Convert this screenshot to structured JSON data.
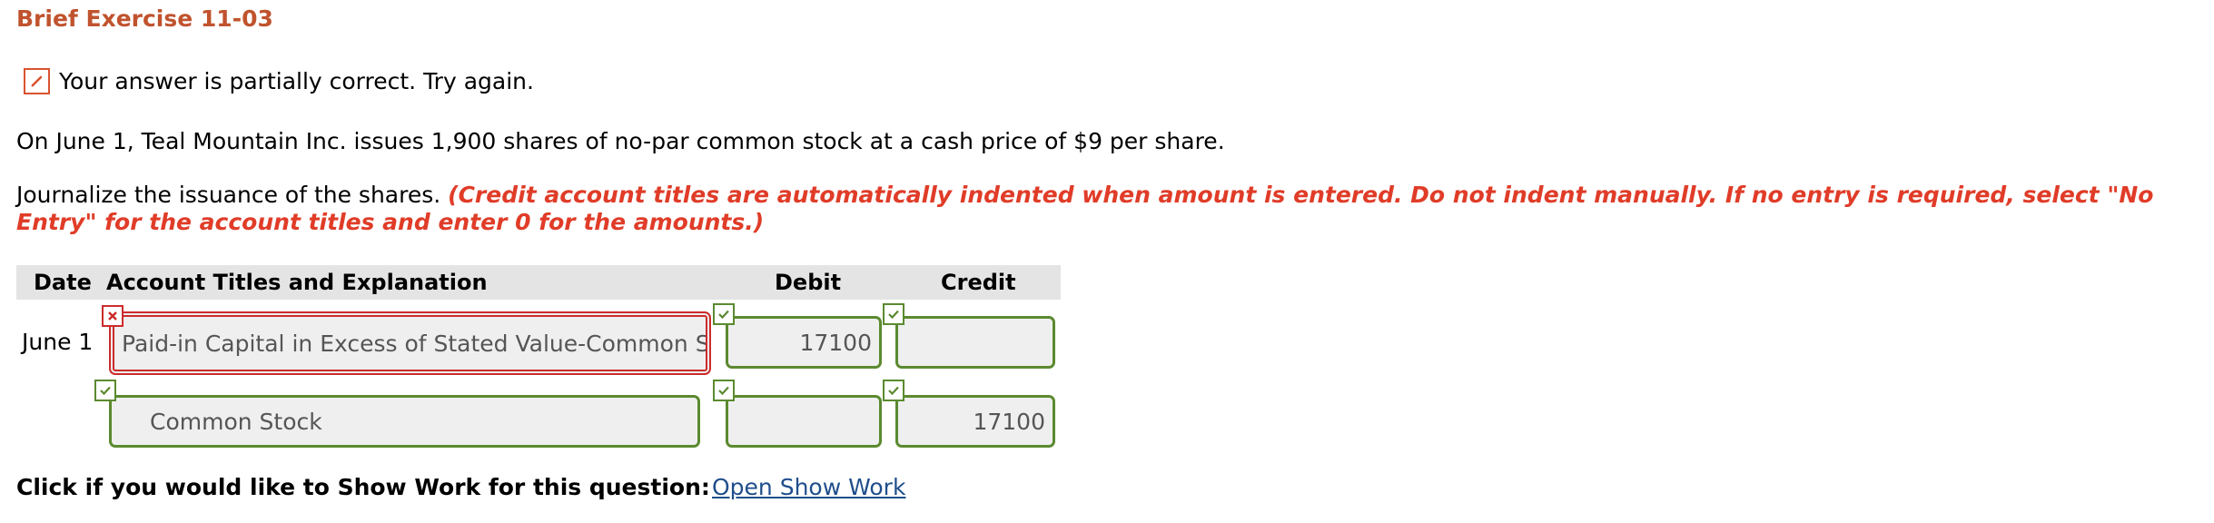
{
  "exercise_title": "Brief Exercise 11-03",
  "feedback": {
    "icon": "pencil-icon",
    "message": "Your answer is partially correct.  Try again."
  },
  "problem_text": "On June 1, Teal Mountain Inc. issues 1,900 shares of no-par common stock at a cash price of $9 per share.",
  "instructions": {
    "text": "Journalize the issuance of the shares. ",
    "note": "(Credit account titles are automatically indented when amount is entered. Do not indent manually. If no entry is required, select \"No Entry\" for the account titles and enter 0 for the amounts.)"
  },
  "journal": {
    "headers": {
      "date": "Date",
      "account": "Account Titles and Explanation",
      "debit": "Debit",
      "credit": "Credit"
    },
    "rows": [
      {
        "date": "June 1",
        "account": "Paid-in Capital in Excess of Stated Value-Common Stock",
        "account_status": "incorrect",
        "debit": "17100",
        "debit_status": "correct",
        "credit": "",
        "credit_status": "correct"
      },
      {
        "date": "",
        "account": "Common Stock",
        "account_status": "correct",
        "debit": "",
        "debit_status": "correct",
        "credit": "17100",
        "credit_status": "correct"
      }
    ]
  },
  "show_work": {
    "prompt": "Click if you would like to Show Work for this question:",
    "link": "Open Show Work"
  },
  "colors": {
    "title": "#c0532e",
    "instruction_note": "#e03c28",
    "correct_border": "#5b8a2f",
    "incorrect_border": "#cc2b2b",
    "link": "#1f4e8c",
    "header_bg": "#e4e4e4"
  }
}
